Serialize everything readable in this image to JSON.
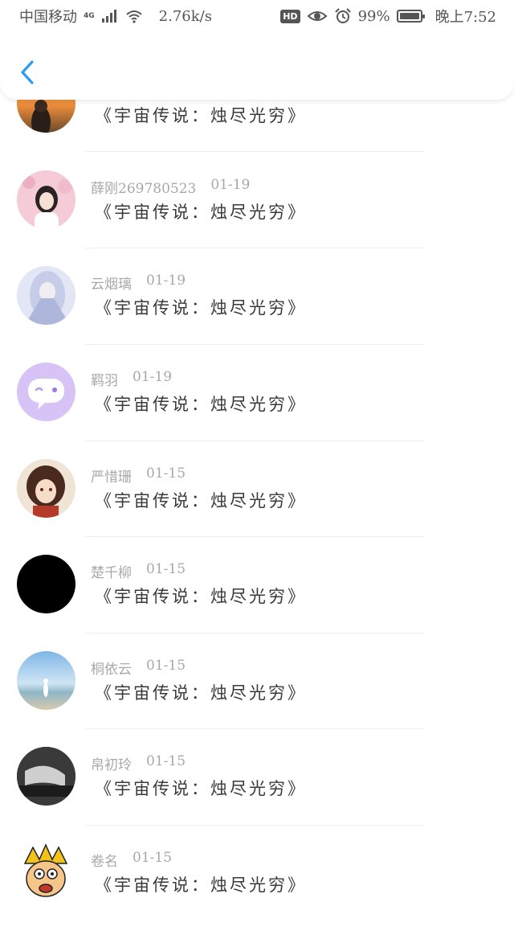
{
  "status_bar": {
    "carrier": "中国移动",
    "network": "4G",
    "speed": "2.76k/s",
    "hd": "HD",
    "battery": "99%",
    "time": "晚上7:52"
  },
  "header": {
    "back_icon": "chevron-left-icon"
  },
  "colors": {
    "accent": "#2b9cf2",
    "name": "#a8a8a8",
    "message": "#3a3a3a"
  },
  "messages": [
    {
      "name": "",
      "date": "",
      "text": "《宇宙传说：烛尽光穷》",
      "avatar": "sunset-photo"
    },
    {
      "name": "薛刚269780523",
      "date": "01-19",
      "text": "《宇宙传说：烛尽光穷》",
      "avatar": "pink-girl-photo"
    },
    {
      "name": "云烟璃",
      "date": "01-19",
      "text": "《宇宙传说：烛尽光穷》",
      "avatar": "anime-white-hair"
    },
    {
      "name": "羁羽",
      "date": "01-19",
      "text": "《宇宙传说：烛尽光穷》",
      "avatar": "purple-chat-bubble"
    },
    {
      "name": "严惜珊",
      "date": "01-15",
      "text": "《宇宙传说：烛尽光穷》",
      "avatar": "anime-girl"
    },
    {
      "name": "楚千柳",
      "date": "01-15",
      "text": "《宇宙传说：烛尽光穷》",
      "avatar": "black-circle"
    },
    {
      "name": "桐依云",
      "date": "01-15",
      "text": "《宇宙传说：烛尽光穷》",
      "avatar": "beach-photo"
    },
    {
      "name": "帛初玲",
      "date": "01-15",
      "text": "《宇宙传说：烛尽光穷》",
      "avatar": "dark-photo"
    },
    {
      "name": "卷名",
      "date": "01-15",
      "text": "《宇宙传说：烛尽光穷》",
      "avatar": "cartoon-face"
    }
  ]
}
